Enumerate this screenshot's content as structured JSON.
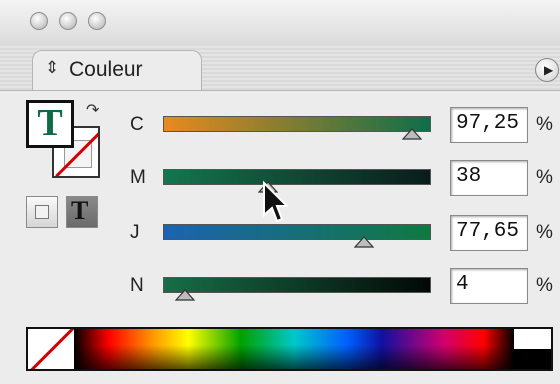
{
  "window": {
    "traffic_lights": [
      "close-button",
      "minimize-button",
      "zoom-button"
    ]
  },
  "panel": {
    "tab_label": "Couleur",
    "tab_icon": "up-down-arrows-icon",
    "menu_icon": "panel-menu-arrow-icon"
  },
  "fill_stroke": {
    "fill_glyph": "T",
    "fill_color": "#0f6b47",
    "stroke": "none",
    "mode_text_glyph": "T"
  },
  "sliders": [
    {
      "channel": "C",
      "value": "97,25",
      "unit": "%",
      "fraction": 0.9725,
      "gradient": [
        "#e88a1e",
        "#0e6e4a"
      ]
    },
    {
      "channel": "M",
      "value": "38",
      "unit": "%",
      "fraction": 0.38,
      "gradient": [
        "#14764e",
        "#0a1c1a"
      ]
    },
    {
      "channel": "J",
      "value": "77,65",
      "unit": "%",
      "fraction": 0.7765,
      "gradient": [
        "#1c63b2",
        "#0e7a40"
      ]
    },
    {
      "channel": "N",
      "value": "4",
      "unit": "%",
      "fraction": 0.04,
      "gradient": [
        "#176e48",
        "#030806"
      ]
    }
  ],
  "spectrum": {
    "none_swatch": "none-swatch",
    "white_swatch": "#ffffff",
    "black_swatch": "#000000"
  }
}
